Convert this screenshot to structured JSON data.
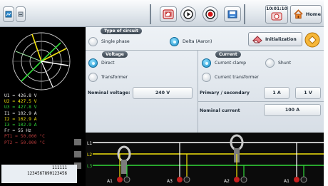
{
  "toolbar": {
    "time_line1": "10:01:10",
    "time_line2": "",
    "home_label": "Home",
    "icons": [
      "display-mode-icon",
      "settings-small-icon",
      "screenshot-icon",
      "play-icon",
      "record-icon",
      "memory-icon",
      "clock-icon",
      "home-icon"
    ]
  },
  "measurements": [
    {
      "text": "U1 = 426.8 V",
      "color": "white"
    },
    {
      "text": "U2 = 427.5 V",
      "color": "yellow"
    },
    {
      "text": "U3 = 427.8 V",
      "color": "green"
    },
    {
      "text": "I1 = 102.9 A",
      "color": "white"
    },
    {
      "text": "I2 = 102.9 A",
      "color": "yellow"
    },
    {
      "text": "I3 = 102.9 A",
      "color": "green"
    },
    {
      "text": "Fr = 55 Hz",
      "color": "white"
    },
    {
      "text": "PT1 = 50.000 °C",
      "color": "red"
    },
    {
      "text": "PT2 = 50.000 °C",
      "color": "red"
    }
  ],
  "serial": {
    "line1": "111111",
    "line2": "1234567890123456"
  },
  "circuit": {
    "title": "Type of circuit",
    "single_phase": "Single phase",
    "delta": "Delta (Aaron)",
    "selected": "delta"
  },
  "voltage": {
    "title": "Voltage",
    "direct": "Direct",
    "transformer": "Transformer",
    "selected": "direct",
    "nominal_label": "Nominal voltage:",
    "nominal_value": "240 V"
  },
  "current": {
    "title": "Current",
    "clamp": "Current clamp",
    "shunt": "Shunt",
    "ct": "Current transformer",
    "selected": "clamp",
    "ratio_label": "Primary / secondary",
    "primary": "1 A",
    "secondary": "1 V",
    "nominal_label": "Nominal current",
    "nominal_value": "100 A"
  },
  "init_label": "Initialization",
  "wiring": {
    "lines": [
      "L1",
      "L2",
      "L3"
    ],
    "channels": [
      "A1",
      "A3",
      "A2",
      "A1"
    ]
  },
  "colors": {
    "l1": "#ffffff",
    "l2": "#f2e20d",
    "l3": "#33d93a",
    "accent": "#1b8fc8"
  }
}
